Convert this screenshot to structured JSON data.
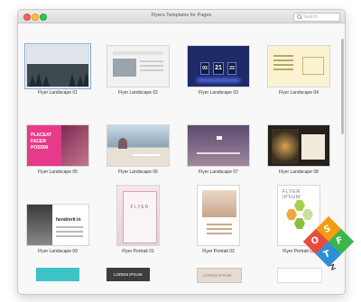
{
  "window": {
    "title": "Flyers Templates for Pages"
  },
  "search": {
    "placeholder": "Search"
  },
  "templates": [
    {
      "label": "Flyer Landscape 01"
    },
    {
      "label": "Flyer Landscape 02"
    },
    {
      "label": "Flyer Landscape 03"
    },
    {
      "label": "Flyer Landscape 04"
    },
    {
      "label": "Flyer Landscape 05"
    },
    {
      "label": "Flyer Landscape 06"
    },
    {
      "label": "Flyer Landscape 07"
    },
    {
      "label": "Flyer Landscape 08"
    },
    {
      "label": "Flyer Landscape 09"
    },
    {
      "label": "Flyer Portrait 01"
    },
    {
      "label": "Flyer Portrait 02"
    },
    {
      "label": "Flyer Portrait 03"
    }
  ],
  "thumb_text": {
    "t3_day": "21",
    "t3_left": "03",
    "t3_right": "23",
    "t5_line1": "PLACEAT",
    "t5_line2": "FACER",
    "t5_line3": "POSSIM",
    "t9_heading": "hendrerit in",
    "t10_heading": "FLYER",
    "t12_heading": "FLYER IPSUM",
    "r5b_heading": "LOREM IPSUM",
    "r5c_heading": "LOREM IPSUM"
  },
  "watermark": {
    "letters": [
      "S",
      "O",
      "F",
      "T",
      "Z"
    ]
  },
  "colors": {
    "accent": "#7ea6e0",
    "close": "#fc605c",
    "minimize": "#fdbc40",
    "maximize": "#34c84a"
  }
}
